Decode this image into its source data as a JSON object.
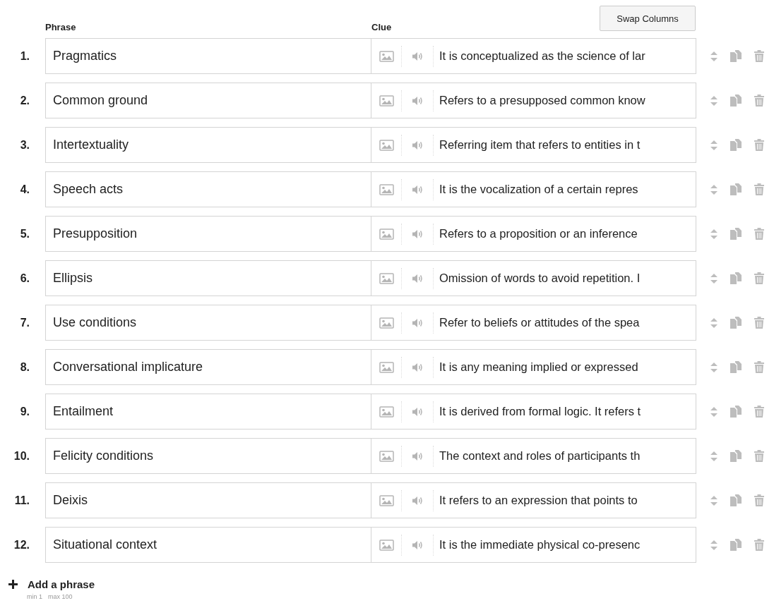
{
  "swap_button": "Swap Columns",
  "columns": {
    "phrase": "Phrase",
    "clue": "Clue"
  },
  "rows": [
    {
      "number": "1.",
      "phrase": "Pragmatics",
      "clue": "It is conceptualized as the science of lar"
    },
    {
      "number": "2.",
      "phrase": "Common ground",
      "clue": "Refers to a presupposed common know"
    },
    {
      "number": "3.",
      "phrase": "Intertextuality",
      "clue": "Referring item that refers to entities in t"
    },
    {
      "number": "4.",
      "phrase": "Speech acts",
      "clue": "It is the vocalization of a certain repres"
    },
    {
      "number": "5.",
      "phrase": "Presupposition",
      "clue": "Refers to a proposition or an inference"
    },
    {
      "number": "6.",
      "phrase": "Ellipsis",
      "clue": "Omission of words to avoid repetition. I"
    },
    {
      "number": "7.",
      "phrase": "Use conditions",
      "clue": "Refer to beliefs or attitudes of the spea"
    },
    {
      "number": "8.",
      "phrase": "Conversational implicature",
      "clue": "It is any meaning implied or expressed"
    },
    {
      "number": "9.",
      "phrase": "Entailment",
      "clue": "It is derived from formal logic. It refers t"
    },
    {
      "number": "10.",
      "phrase": "Felicity conditions",
      "clue": "The context and roles of participants th"
    },
    {
      "number": "11.",
      "phrase": "Deixis",
      "clue": "It refers to an expression that points to"
    },
    {
      "number": "12.",
      "phrase": "Situational context",
      "clue": "It is the immediate physical co-presenc"
    }
  ],
  "add_button": "Add a phrase",
  "limits": {
    "min": "min 1",
    "max": "max 100"
  }
}
